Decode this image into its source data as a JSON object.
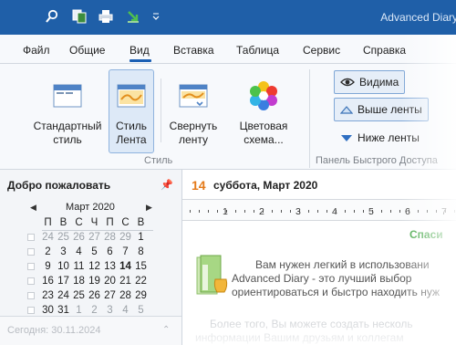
{
  "app": {
    "title": "Advanced Diary"
  },
  "quick_access": {
    "icons": [
      "search-icon",
      "copy-icon",
      "print-icon",
      "download-icon",
      "dropdown-icon"
    ]
  },
  "menu": {
    "items": [
      {
        "label": "Файл"
      },
      {
        "label": "Общие"
      },
      {
        "label": "Вид",
        "active": true
      },
      {
        "label": "Вставка"
      },
      {
        "label": "Таблица"
      },
      {
        "label": "Сервис"
      },
      {
        "label": "Справка"
      }
    ]
  },
  "ribbon": {
    "style_group": {
      "label": "Стиль",
      "buttons": [
        {
          "label_1": "Стандартный",
          "label_2": "стиль",
          "icon": "window-standard-icon"
        },
        {
          "label_1": "Стиль",
          "label_2": "Лента",
          "icon": "window-ribbon-icon",
          "selected": true
        },
        {
          "label_1": "Свернуть",
          "label_2": "ленту",
          "icon": "window-collapse-icon"
        },
        {
          "label_1": "Цветовая",
          "label_2": "схема...",
          "icon": "color-scheme-icon"
        }
      ]
    },
    "qa_group": {
      "label": "Панель Быстрого Доступа",
      "options": [
        {
          "label": "Видима",
          "icon": "eye-icon"
        },
        {
          "label": "Выше ленты",
          "icon": "triangle-up-icon"
        },
        {
          "label": "Ниже ленты",
          "icon": "triangle-down-icon"
        }
      ]
    }
  },
  "sidebar": {
    "title": "Добро пожаловать",
    "calendar": {
      "month_label": "Март 2020",
      "weekdays": [
        "П",
        "В",
        "С",
        "Ч",
        "П",
        "С",
        "В"
      ],
      "weeks": [
        [
          "24",
          "25",
          "26",
          "27",
          "28",
          "29",
          "1"
        ],
        [
          "2",
          "3",
          "4",
          "5",
          "6",
          "7",
          "8"
        ],
        [
          "9",
          "10",
          "11",
          "12",
          "13",
          "14",
          "15"
        ],
        [
          "16",
          "17",
          "18",
          "19",
          "20",
          "21",
          "22"
        ],
        [
          "23",
          "24",
          "25",
          "26",
          "27",
          "28",
          "29"
        ],
        [
          "30",
          "31",
          "1",
          "2",
          "3",
          "4",
          "5"
        ]
      ],
      "today": "14"
    },
    "footer": "Сегодня: 30.11.2024"
  },
  "main": {
    "day": "14",
    "date_text": "суббота, Март 2020",
    "ruler_numbers": [
      "1",
      "2",
      "3",
      "4",
      "5",
      "6",
      "7"
    ],
    "doc_title": "Спаси",
    "para_1": [
      "Вам нужен легкий в использовани",
      "Advanced Diary - это лучший выбор",
      "ориентироваться и быстро находить нуж"
    ],
    "para_2": [
      "Более того, Вы можете создать несколь",
      "информации Вашим друзьям и коллегам"
    ]
  }
}
